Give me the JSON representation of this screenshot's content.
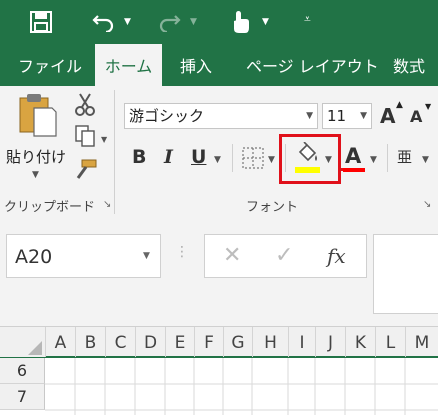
{
  "qat": {
    "save_icon": "save-icon",
    "undo_icon": "undo-icon",
    "redo_icon": "redo-icon",
    "touch_icon": "touch-mode-icon",
    "customize_icon": "customize-qat-icon"
  },
  "tabs": [
    {
      "label": "ファイル",
      "active": false
    },
    {
      "label": "ホーム",
      "active": true
    },
    {
      "label": "挿入",
      "active": false
    },
    {
      "label": "ページ レイアウト",
      "active": false
    },
    {
      "label": "数式",
      "active": false
    }
  ],
  "clipboard": {
    "paste_label": "貼り付け",
    "group_label": "クリップボード"
  },
  "font_group": {
    "font_name": "游ゴシック",
    "font_size": "11",
    "bold": "B",
    "italic": "I",
    "underline": "U",
    "font_color_glyph": "A",
    "grow_font": "A",
    "shrink_font": "A",
    "phonetic": "亜",
    "group_label": "フォント",
    "fill_color": "#ffff00",
    "font_color": "#ff0000",
    "highlight_color": "#e0101a"
  },
  "formula_bar": {
    "name_box": "A20",
    "cancel": "✕",
    "enter": "✓",
    "fx": "fx"
  },
  "grid": {
    "columns": [
      "A",
      "B",
      "C",
      "D",
      "E",
      "F",
      "G",
      "H",
      "I",
      "J",
      "K",
      "L",
      "M"
    ],
    "rows": [
      "6",
      "7"
    ]
  },
  "colors": {
    "accent": "#217346"
  }
}
